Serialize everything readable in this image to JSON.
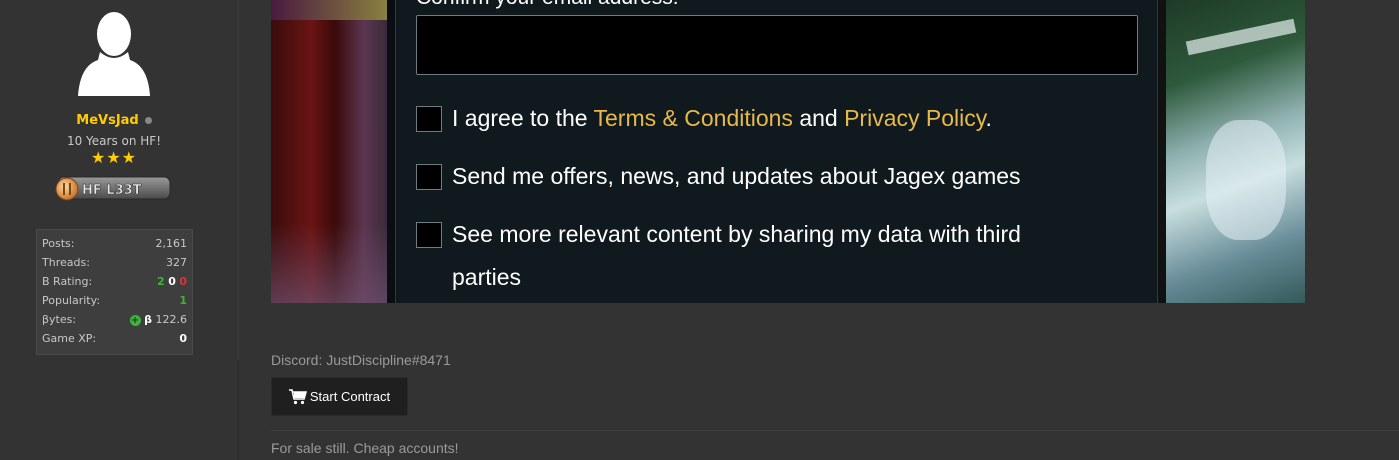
{
  "user": {
    "username": "MeVsJad",
    "tenure": "10 Years on HF!",
    "stars": "★★★",
    "badge_text": "HF L33T",
    "colors": {
      "username": "#ffcc00",
      "stars": "#ffcc00"
    }
  },
  "stats": {
    "rows": [
      {
        "label": "Posts:",
        "value": "2,161"
      },
      {
        "label": "Threads:",
        "value": "327"
      },
      {
        "label": "B Rating:",
        "positive": "2",
        "neutral": "0",
        "negative": "0"
      },
      {
        "label": "Popularity:",
        "value": "1"
      },
      {
        "label": "βytes:",
        "beta_symbol": "β",
        "value": "122.6"
      },
      {
        "label": "Game XP:",
        "value": "0"
      }
    ]
  },
  "form": {
    "confirm_label": "Confirm your email address:",
    "email_value": "",
    "agree_prefix": "I agree to the ",
    "terms_link": "Terms & Conditions",
    "agree_middle": " and ",
    "privacy_link": "Privacy Policy",
    "agree_suffix": ".",
    "offers_text": "Send me offers, news, and updates about Jagex games",
    "share_text": "See more relevant content by sharing my data with third parties",
    "link_color": "#e8b84a"
  },
  "post": {
    "discord": "Discord: JustDiscipline#8471",
    "contract_button": "Start Contract",
    "sale_text": "For sale still. Cheap accounts!"
  }
}
